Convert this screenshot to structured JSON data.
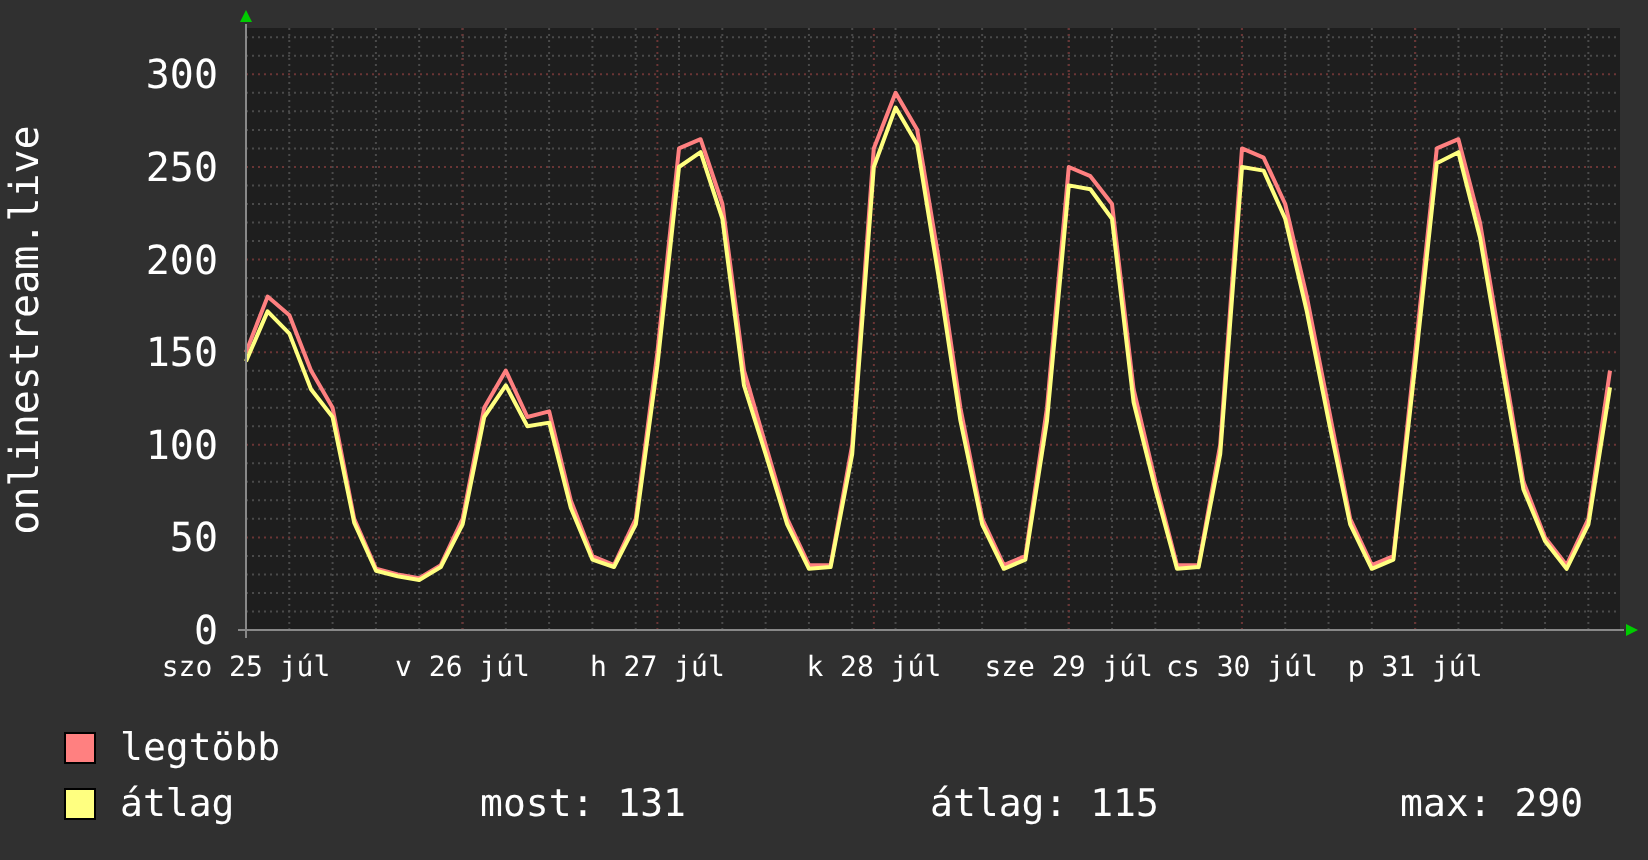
{
  "chart": {
    "chart_data": {
      "type": "line",
      "ylabel": "onlinestream.live",
      "categories": [
        "szo 25 júl",
        null,
        null,
        null,
        null,
        null,
        null,
        null,
        null,
        null,
        "v 26 júl",
        null,
        null,
        null,
        null,
        null,
        null,
        null,
        null,
        "h 27 júl",
        null,
        null,
        null,
        null,
        null,
        null,
        null,
        null,
        null,
        "k 28 júl",
        null,
        null,
        null,
        null,
        null,
        null,
        null,
        null,
        "sze 29 júl",
        null,
        null,
        null,
        null,
        null,
        null,
        null,
        "cs 30 júl",
        null,
        null,
        null,
        null,
        null,
        null,
        null,
        "p 31 júl",
        null,
        null,
        null,
        null,
        null,
        null,
        null,
        null,
        null
      ],
      "series": [
        {
          "name": "legtöbb",
          "color": "#ff8080",
          "values": [
            150,
            180,
            170,
            140,
            120,
            60,
            33,
            30,
            28,
            35,
            60,
            120,
            140,
            115,
            118,
            70,
            40,
            35,
            60,
            150,
            260,
            265,
            230,
            140,
            100,
            60,
            35,
            35,
            100,
            260,
            290,
            270,
            200,
            120,
            60,
            35,
            40,
            120,
            250,
            245,
            230,
            130,
            80,
            35,
            35,
            100,
            260,
            255,
            230,
            180,
            120,
            60,
            35,
            40,
            150,
            260,
            265,
            220,
            150,
            80,
            50,
            35,
            60,
            140
          ]
        },
        {
          "name": "átlag",
          "color": "#ffff80",
          "values": [
            145,
            172,
            160,
            130,
            115,
            58,
            32,
            29,
            27,
            34,
            57,
            115,
            132,
            110,
            112,
            66,
            38,
            34,
            57,
            143,
            250,
            258,
            222,
            132,
            95,
            57,
            33,
            34,
            95,
            250,
            282,
            262,
            190,
            113,
            57,
            33,
            38,
            113,
            240,
            238,
            222,
            123,
            76,
            33,
            34,
            95,
            250,
            248,
            222,
            172,
            113,
            57,
            33,
            38,
            143,
            252,
            258,
            212,
            143,
            76,
            48,
            33,
            57,
            131
          ]
        }
      ],
      "ylim": [
        0,
        325
      ],
      "grid": true,
      "yticks": [
        0,
        50,
        100,
        150,
        200,
        250,
        300
      ]
    }
  },
  "legend": {
    "stats": [
      "most: 131",
      "átlag: 115",
      "max: 290"
    ]
  }
}
